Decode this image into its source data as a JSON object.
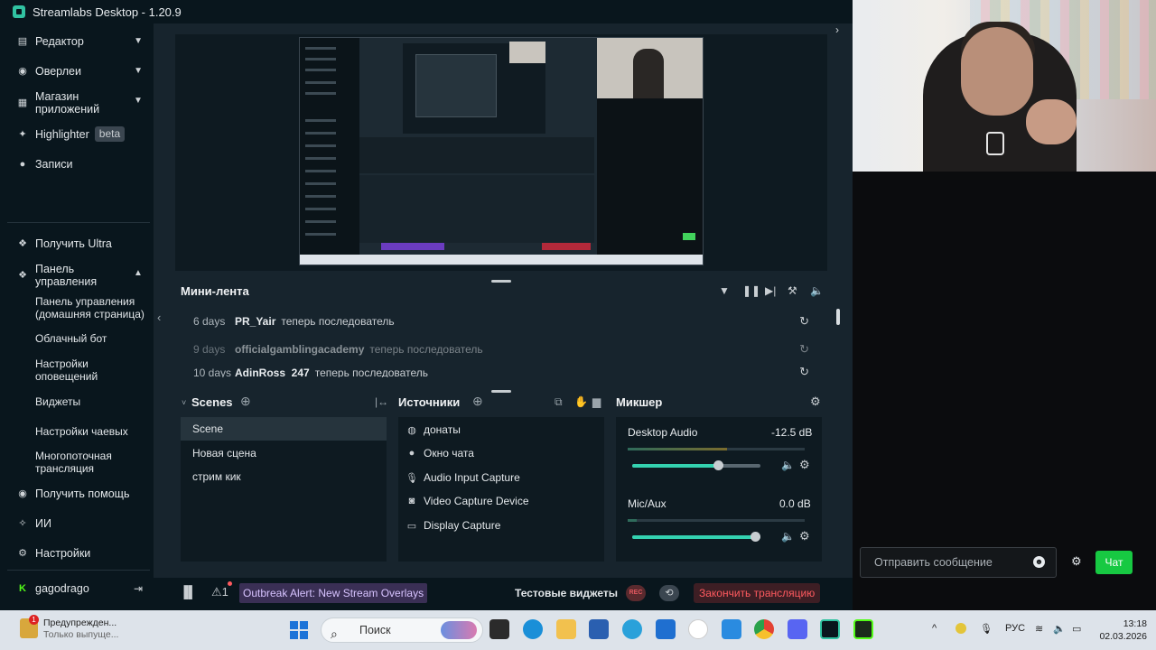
{
  "window": {
    "title": "Streamlabs Desktop - 1.20.9"
  },
  "sidebar": {
    "top_items": [
      {
        "label": "Редактор",
        "icon": "editor-icon"
      },
      {
        "label": "Оверлеи",
        "icon": "overlays-icon"
      },
      {
        "label": "Магазин приложений",
        "icon": "app-store-icon"
      },
      {
        "label": "Highlighter",
        "icon": "highlighter-icon",
        "badge": "beta"
      },
      {
        "label": "Записи",
        "icon": "recordings-icon"
      }
    ],
    "ultra_label": "Получить Ultra",
    "dashboard_label": "Панель управления",
    "dashboard_sub": [
      "Панель управления (домашняя страница)",
      "Облачный бот",
      "Настройки оповещений",
      "Виджеты",
      "Настройки чаевых",
      "Многопоточная трансляция"
    ],
    "help_label": "Получить помощь",
    "ai_label": "ИИ",
    "settings_label": "Настройки",
    "user_name": "gagodrago"
  },
  "mini_feed": {
    "title": "Мини-лента",
    "events": [
      {
        "age": "6 days",
        "user": "PR_Yair",
        "action": "теперь последователь"
      },
      {
        "age": "9 days",
        "user": "officialgamblingacademy",
        "action": "теперь последователь"
      },
      {
        "age": "10 days",
        "user": "AdinRoss_247",
        "action": "теперь последователь"
      }
    ]
  },
  "scenes": {
    "title": "Scenes",
    "items": [
      "Scene",
      "Новая сцена",
      "стрим кик"
    ],
    "selected": "Scene"
  },
  "sources": {
    "title": "Источники",
    "items": [
      {
        "label": "донаты",
        "icon": "globe-icon"
      },
      {
        "label": "Окно чата",
        "icon": "chat-bubble-icon"
      },
      {
        "label": "Audio Input Capture",
        "icon": "microphone-icon"
      },
      {
        "label": "Video Capture Device",
        "icon": "webcam-icon"
      },
      {
        "label": "Display Capture",
        "icon": "monitor-icon"
      }
    ]
  },
  "mixer": {
    "title": "Микшер",
    "channels": [
      {
        "name": "Desktop Audio",
        "db": "-12.5 dB",
        "volume": 0.67
      },
      {
        "name": "Mic/Aux",
        "db": "0.0 dB",
        "volume": 1.0
      }
    ]
  },
  "footer": {
    "alert_text": "Outbreak Alert: New Stream Overlays",
    "test_widgets": "Тестовые виджеты",
    "rec_label": "REC",
    "end_stream": "Закончить трансляцию"
  },
  "chat": {
    "placeholder": "Отправить сообщение",
    "send_label": "Чат"
  },
  "taskbar": {
    "notification_title": "Предупрежден...",
    "notification_sub": "Только выпуще...",
    "notification_count": "1",
    "search_placeholder": "Поиск",
    "language": "РУС",
    "time": "13:18",
    "date": "02.03.2026"
  },
  "colors": {
    "accent": "#31c3a2",
    "danger": "#ff5a5f",
    "chat_send": "#17c942",
    "sidebar_bg": "#09161d"
  }
}
